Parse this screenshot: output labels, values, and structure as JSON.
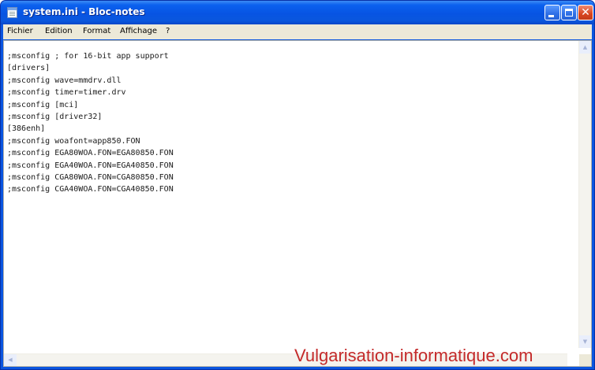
{
  "window": {
    "title": "system.ini - Bloc-notes"
  },
  "menu": {
    "items": [
      "Fichier",
      "Edition",
      "Format",
      "Affichage",
      "?"
    ]
  },
  "document": {
    "lines": [
      ";msconfig ; for 16-bit app support",
      "[drivers]",
      ";msconfig wave=mmdrv.dll",
      ";msconfig timer=timer.drv",
      ";msconfig [mci]",
      ";msconfig [driver32]",
      "[386enh]",
      ";msconfig woafont=app850.FON",
      ";msconfig EGA80WOA.FON=EGA80850.FON",
      ";msconfig EGA40WOA.FON=EGA40850.FON",
      ";msconfig CGA80WOA.FON=CGA80850.FON",
      ";msconfig CGA40WOA.FON=CGA40850.FON"
    ]
  },
  "watermark": {
    "text": "Vulgarisation-informatique.com"
  },
  "colors": {
    "titlebar": "#0754e3",
    "menubar": "#ece9d8",
    "watermark": "#c42a2a"
  },
  "icons": {
    "app": "notepad-icon",
    "minimize": "minimize-icon",
    "maximize": "maximize-icon",
    "close": "close-icon"
  }
}
